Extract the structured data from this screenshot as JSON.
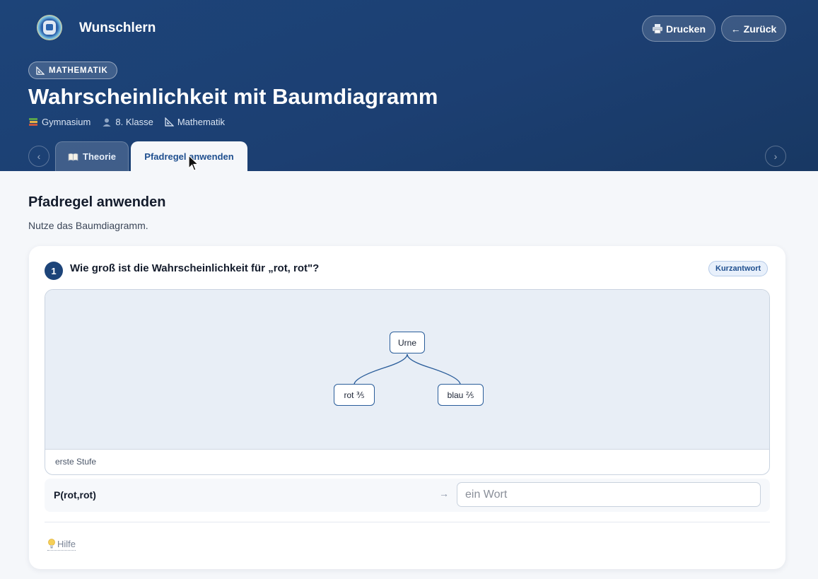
{
  "app": {
    "title": "Wunschlern"
  },
  "header": {
    "print_label": "Drucken",
    "print_icon": "printer-icon",
    "back_label": "Zurück",
    "back_icon": "arrow-left-icon",
    "subject_badge": "MATHEMATIK",
    "subject_icon": "triangle-ruler-icon",
    "title": "Wahrscheinlichkeit mit Baumdiagramm",
    "meta": {
      "school": "Gymnasium",
      "grade": "8. Klasse",
      "subject": "Mathematik"
    }
  },
  "tabs": [
    {
      "label": "Theorie",
      "icon": "book-icon",
      "active": false
    },
    {
      "label": "Pfadregel anwenden",
      "active": true
    }
  ],
  "section": {
    "title": "Pfadregel anwenden",
    "subtitle": "Nutze das Baumdiagramm."
  },
  "question": {
    "number": "1",
    "text": "Wie groß ist die Wahrscheinlichkeit für „rot, rot\"?",
    "type": "Kurzantwort",
    "figure": {
      "root": "Urne",
      "left": "rot ⅗",
      "right": "blau ⅖",
      "caption": "erste Stufe"
    },
    "answer": {
      "label": "P(rot,rot)",
      "placeholder": "ein Wort",
      "value": ""
    },
    "hint_label": "Hilfe"
  },
  "colors": {
    "header_bg": "#1d4479",
    "accent": "#1f4f8f",
    "figure_bg": "#e8eef6"
  }
}
